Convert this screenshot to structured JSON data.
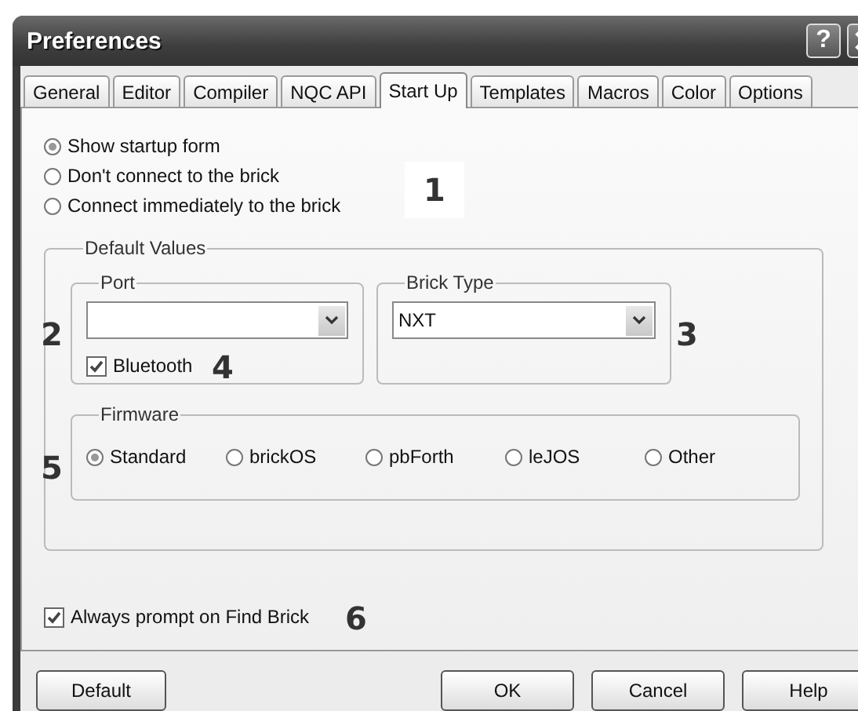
{
  "window": {
    "title": "Preferences"
  },
  "title_buttons": [
    {
      "kind": "help",
      "label": "?"
    },
    {
      "kind": "close"
    }
  ],
  "tabs": [
    {
      "label": "General",
      "selected": false
    },
    {
      "label": "Editor",
      "selected": false
    },
    {
      "label": "Compiler",
      "selected": false
    },
    {
      "label": "NQC API",
      "selected": false
    },
    {
      "label": "Start Up",
      "selected": true
    },
    {
      "label": "Templates",
      "selected": false
    },
    {
      "label": "Macros",
      "selected": false
    },
    {
      "label": "Color",
      "selected": false
    },
    {
      "label": "Options",
      "selected": false
    }
  ],
  "startup": {
    "callout": "1",
    "options": [
      {
        "label": "Show startup form",
        "selected": true
      },
      {
        "label": "Don't connect to the brick",
        "selected": false
      },
      {
        "label": "Connect immediately to the brick",
        "selected": false
      }
    ]
  },
  "default_values": {
    "title": "Default Values",
    "port": {
      "title": "Port",
      "callout": "2",
      "bluetooth": {
        "label": "Bluetooth",
        "checked": true,
        "callout": "4"
      }
    },
    "brick_type": {
      "title": "Brick Type",
      "value": "NXT",
      "callout": "3"
    },
    "firmware": {
      "title": "Firmware",
      "callout": "5",
      "options": [
        {
          "label": "Standard",
          "selected": true
        },
        {
          "label": "brickOS",
          "selected": false
        },
        {
          "label": "pbForth",
          "selected": false
        },
        {
          "label": "leJOS",
          "selected": false
        },
        {
          "label": "Other",
          "selected": false
        }
      ]
    }
  },
  "always_prompt": {
    "label": "Always prompt on Find Brick",
    "checked": true,
    "callout": "6"
  },
  "left_button": {
    "label": "Default"
  },
  "buttons": [
    {
      "label": "OK"
    },
    {
      "label": "Cancel"
    },
    {
      "label": "Help"
    }
  ]
}
